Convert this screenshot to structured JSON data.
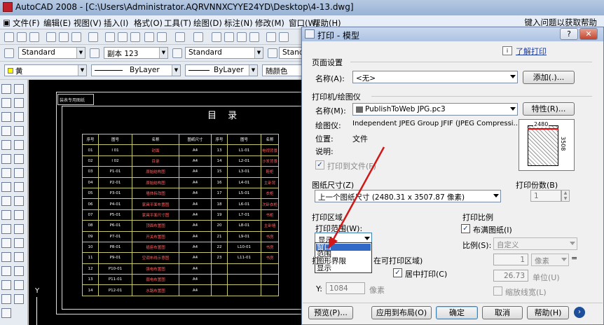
{
  "app": {
    "title": "AutoCAD 2008 - [C:\\Users\\Administrator.AQRVNNXCYYE24YD\\Desktop\\4-13.dwg]",
    "help_search": "键入问题以获取帮助"
  },
  "menu": [
    "文件(F)",
    "编辑(E)",
    "视图(V)",
    "插入(I)",
    "格式(O)",
    "工具(T)",
    "绘图(D)",
    "标注(N)",
    "修改(M)",
    "窗口(W)",
    "帮助(H)"
  ],
  "toolbar": {
    "text_style": "Standard",
    "dim_style": "副本 123",
    "table_style": "Standard",
    "table_style2": "Stand",
    "layer": "黄",
    "linetype": "ByLayer",
    "lineweight": "ByLayer",
    "plot_color": "随颜色"
  },
  "drawing": {
    "block_label": "装表专用图纸",
    "title": "目 录",
    "headers": [
      "序号",
      "图号",
      "名称",
      "图纸尺寸",
      "序号",
      "图号",
      "名称"
    ],
    "rows": [
      [
        "01",
        "I 01",
        "封面",
        "A4",
        "13",
        "L1-01",
        "电视背景"
      ],
      [
        "02",
        "I 02",
        "目录",
        "A4",
        "14",
        "L2-01",
        "沙发背景"
      ],
      [
        "03",
        "P1-01",
        "原始结构图",
        "A4",
        "15",
        "L3-01",
        "鞋柜"
      ],
      [
        "04",
        "P2-01",
        "原始结构图",
        "A4",
        "16",
        "L4-01",
        "主卧背"
      ],
      [
        "05",
        "P3-01",
        "墙体拆改图",
        "A4",
        "17",
        "L5-01",
        "衣柜"
      ],
      [
        "06",
        "P4-01",
        "家具平面布置图",
        "A4",
        "18",
        "L6-01",
        "次卧衣柜"
      ],
      [
        "07",
        "P5-01",
        "家具平面尺寸图",
        "A4",
        "19",
        "L7-01",
        "书柜"
      ],
      [
        "08",
        "P6-01",
        "顶面布置图",
        "A4",
        "20",
        "L8-01",
        "主卧墙"
      ],
      [
        "09",
        "P7-01",
        "开关布置图",
        "A4",
        "21",
        "L9-01",
        "书房"
      ],
      [
        "10",
        "P8-01",
        "插座布置图",
        "A4",
        "22",
        "L10-01",
        "书房"
      ],
      [
        "11",
        "P9-01",
        "空调布线示意图",
        "A4",
        "23",
        "L11-01",
        "书房"
      ],
      [
        "12",
        "P10-01",
        "强电布置图",
        "A4",
        "",
        "",
        ""
      ],
      [
        "13",
        "P11-01",
        "弱电布置图",
        "A4",
        "",
        "",
        ""
      ],
      [
        "14",
        "P12-01",
        "水路布置图",
        "A4",
        "",
        "",
        ""
      ]
    ],
    "ucs_label": "Y"
  },
  "dialog": {
    "title": "打印 - 模型",
    "help_link": "了解打印",
    "page_setup": {
      "heading": "页面设置",
      "name_label": "名称(A):",
      "name_value": "<无>",
      "add_button": "添加(.)..."
    },
    "printer": {
      "heading": "打印机/绘图仪",
      "name_label": "名称(M):",
      "name_value": "PublishToWeb JPG.pc3",
      "properties_button": "特性(R)...",
      "plotter_label": "绘图仪:",
      "plotter_value": "Independent JPEG Group JFIF (JPEG Compressi...",
      "location_label": "位置:",
      "location_value": "文件",
      "description_label": "说明:",
      "plot_to_file": "打印到文件(F)",
      "preview_width": "2480",
      "preview_height": "3508"
    },
    "paper_size": {
      "heading": "图纸尺寸(Z)",
      "value": "上一个图纸尺寸  (2480.31 x 3507.87 像素)"
    },
    "copies": {
      "heading": "打印份数(B)",
      "value": "1"
    },
    "plot_area": {
      "heading": "打印区域",
      "range_label": "打印范围(W):",
      "range_value": "显示",
      "options": [
        "窗口",
        "范围",
        "图形界限",
        "显示"
      ],
      "selected_option": "窗口"
    },
    "plot_offset": {
      "heading_partial": "打",
      "heading_tail": "在可打印区域)",
      "center_label": "居中打印(C)",
      "y_label": "Y:",
      "y_value": "1084",
      "y_unit": "像素"
    },
    "plot_scale": {
      "heading": "打印比例",
      "fit_label": "布满图纸(I)",
      "scale_label": "比例(S):",
      "scale_value": "自定义",
      "value1": "1",
      "unit1": "像素",
      "value2": "26.73",
      "unit2": "单位(U)",
      "lineweights": "缩放线宽(L)"
    },
    "buttons": {
      "preview": "预览(P)...",
      "apply": "应用到布局(O)",
      "ok": "确定",
      "cancel": "取消",
      "help": "帮助(H)"
    }
  }
}
